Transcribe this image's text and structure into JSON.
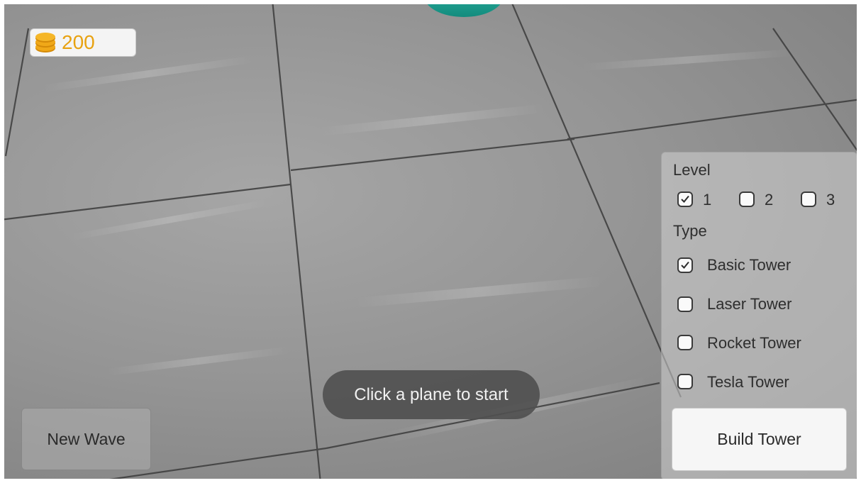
{
  "hud": {
    "coins": "200"
  },
  "toast": {
    "message": "Click a plane to start"
  },
  "buttons": {
    "new_wave": "New Wave",
    "build_tower": "Build Tower"
  },
  "panel": {
    "level_label": "Level",
    "levels": [
      {
        "label": "1",
        "checked": true
      },
      {
        "label": "2",
        "checked": false
      },
      {
        "label": "3",
        "checked": false
      }
    ],
    "type_label": "Type",
    "types": [
      {
        "label": "Basic Tower",
        "checked": true
      },
      {
        "label": "Laser Tower",
        "checked": false
      },
      {
        "label": "Rocket Tower",
        "checked": false
      },
      {
        "label": "Tesla Tower",
        "checked": false
      }
    ]
  },
  "colors": {
    "coin_text": "#e8a211",
    "toast_bg": "#505050"
  },
  "icons": {
    "coin": "coin-stack-icon",
    "check": "checkmark-icon"
  }
}
